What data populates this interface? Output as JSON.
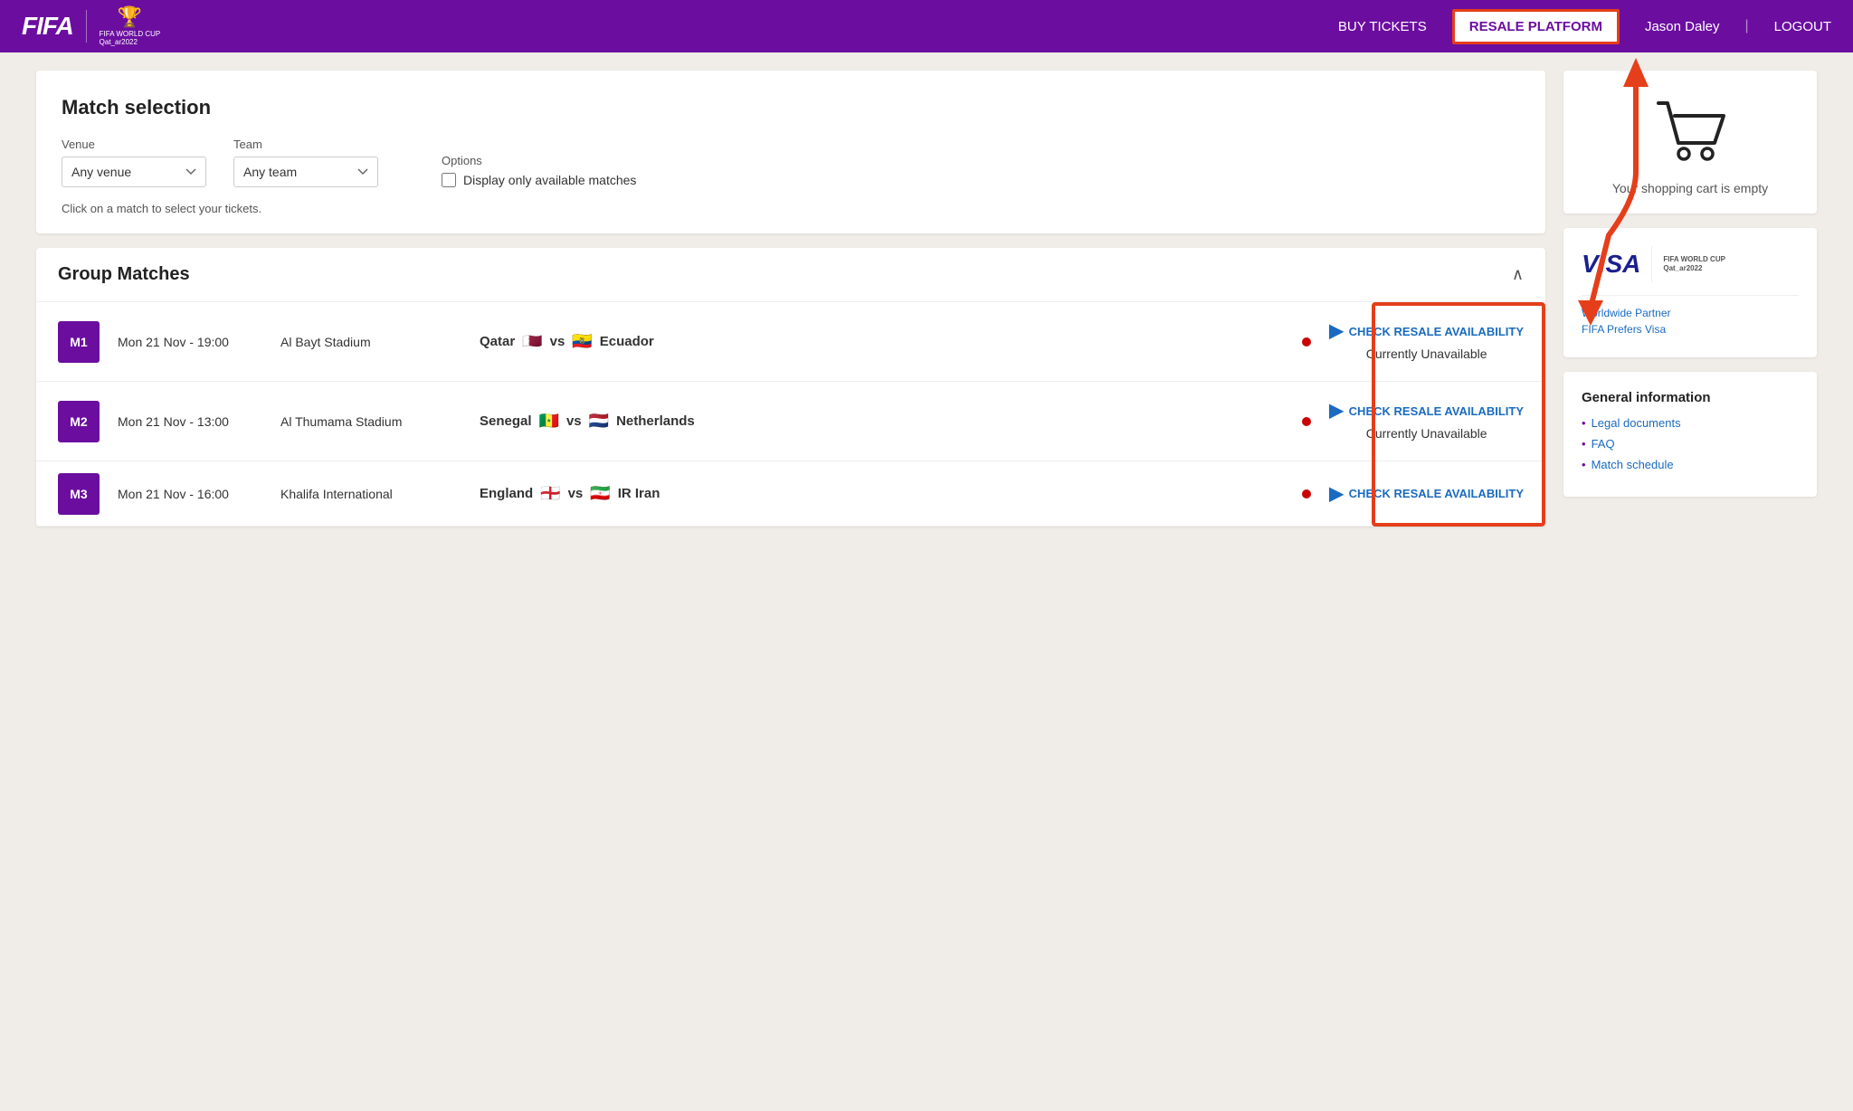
{
  "header": {
    "fifa_label": "FIFA",
    "world_cup_label": "FIFA WORLD CUP\nQat_ar2022",
    "nav": {
      "buy_tickets": "BUY TICKETS",
      "resale_platform": "RESALE PLATFORM",
      "user_name": "Jason Daley",
      "logout": "LOGOUT"
    }
  },
  "match_selection": {
    "title": "Match selection",
    "venue_label": "Venue",
    "venue_value": "Any venue",
    "team_label": "Team",
    "team_value": "Any team",
    "options_label": "Options",
    "display_available_label": "Display only available matches",
    "helper_text": "Click on a match to select your tickets."
  },
  "group_matches": {
    "title": "Group Matches",
    "matches": [
      {
        "id": "M1",
        "date": "Mon 21 Nov - 19:00",
        "venue": "Al Bayt Stadium",
        "team1": "Qatar",
        "flag1": "🇶🇦",
        "vs": "vs",
        "team2": "Ecuador",
        "flag2": "🇪🇨",
        "resale_btn": "CHECK RESALE AVAILABILITY",
        "status": "Currently Unavailable"
      },
      {
        "id": "M2",
        "date": "Mon 21 Nov - 13:00",
        "venue": "Al Thumama Stadium",
        "team1": "Senegal",
        "flag1": "🇸🇳",
        "vs": "vs",
        "team2": "Netherlands",
        "flag2": "🇳🇱",
        "resale_btn": "CHECK RESALE AVAILABILITY",
        "status": "Currently Unavailable"
      },
      {
        "id": "M3",
        "date": "Mon 21 Nov - 16:00",
        "venue": "Khalifa International",
        "team1": "England",
        "flag1": "🏴󠁧󠁢󠁥󠁮󠁧󠁿",
        "vs": "vs",
        "team2": "IR Iran",
        "flag2": "🇮🇷",
        "resale_btn": "CHECK RESALE AVAILABILITY",
        "status": ""
      }
    ]
  },
  "cart": {
    "empty_text": "Your shopping cart is empty"
  },
  "visa": {
    "visa_label": "VISA",
    "wc_label": "FIFA WORLD CUP\nQat_ar2022",
    "worldwide_partner": "Worldwide Partner",
    "fifa_prefers": "FIFA Prefers Visa"
  },
  "general_info": {
    "title": "General information",
    "links": [
      "Legal documents",
      "FAQ",
      "Match schedule"
    ]
  }
}
